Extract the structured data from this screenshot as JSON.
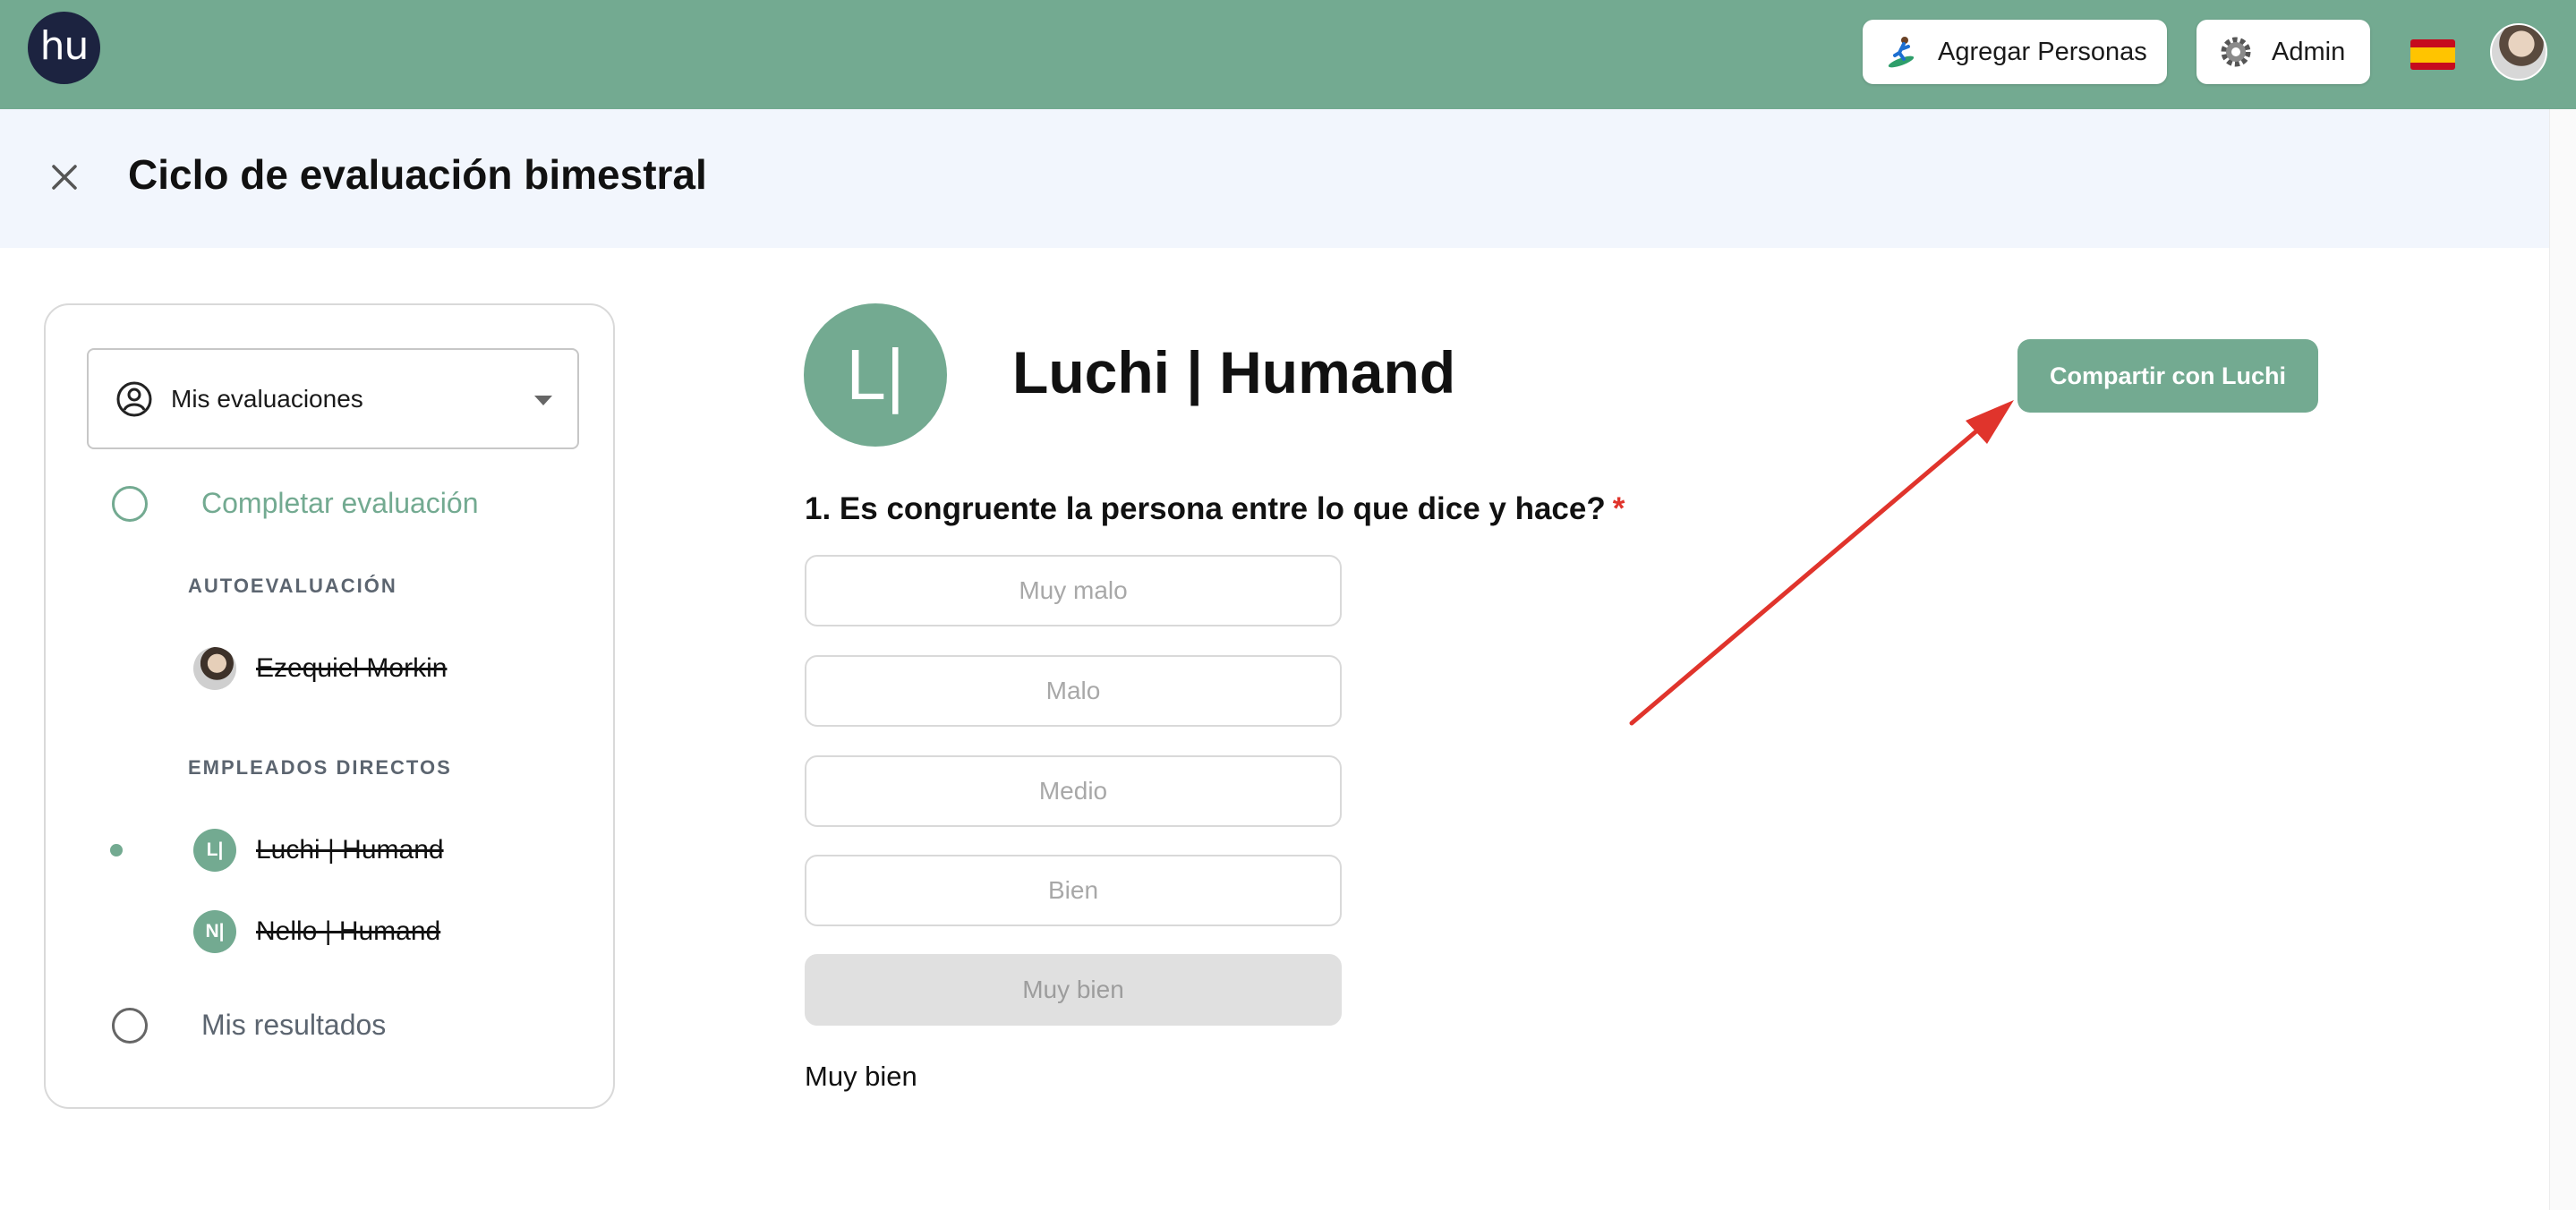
{
  "app": {
    "logo_text": "hu",
    "brand_color": "#73aa91"
  },
  "topbar": {
    "add_people_label": "Agregar Personas",
    "admin_label": "Admin",
    "language_flag": "spain-flag-icon"
  },
  "header": {
    "title": "Ciclo de evaluación bimestral"
  },
  "sidebar": {
    "selector_value": "Mis evaluaciones",
    "steps": [
      {
        "label": "Completar evaluación",
        "state": "active"
      },
      {
        "label": "Mis resultados",
        "state": "pending"
      }
    ],
    "sections": [
      {
        "label": "AUTOEVALUACIÓN",
        "people": [
          {
            "name": "Ezequiel Morkin",
            "avatar": "photo",
            "completed": true
          }
        ]
      },
      {
        "label": "EMPLEADOS DIRECTOS",
        "people": [
          {
            "name": "Luchi | Humand",
            "initials": "L|",
            "completed": true,
            "current": true
          },
          {
            "name": "Nello | Humand",
            "initials": "N|",
            "completed": true,
            "current": false
          }
        ]
      }
    ]
  },
  "main": {
    "avatar_initials": "L|",
    "person_name": "Luchi | Humand",
    "share_button": "Compartir con Luchi",
    "question": {
      "text": "1. Es congruente la persona entre lo que dice y hace?",
      "required_marker": "*",
      "options": [
        "Muy malo",
        "Malo",
        "Medio",
        "Bien",
        "Muy bien"
      ],
      "selected": "Muy bien"
    },
    "answer_text": "Muy bien"
  },
  "colors": {
    "accent": "#73aa91",
    "required": "#e0342c",
    "annotation_arrow": "#e0342c"
  }
}
